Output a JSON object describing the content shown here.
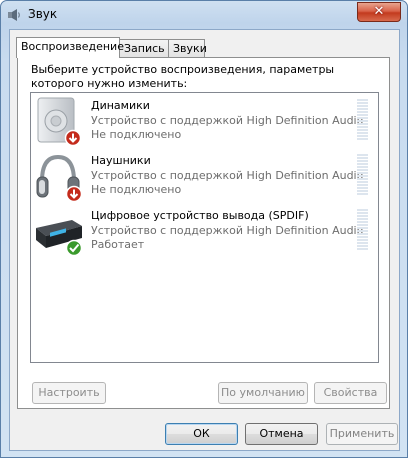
{
  "window": {
    "title": "Звук",
    "app_icon": "speaker-icon",
    "close_glyph": "✕"
  },
  "tabs": [
    {
      "label": "Воспроизведение",
      "active": true
    },
    {
      "label": "Запись",
      "active": false
    },
    {
      "label": "Звуки",
      "active": false
    }
  ],
  "instruction": "Выберите устройство воспроизведения, параметры которого нужно изменить:",
  "devices": [
    {
      "name": "Динамики",
      "description": "Устройство с поддержкой High Definition Audio",
      "status": "Не подключено",
      "icon": "speakers-icon",
      "badge": "disconnected-badge-icon"
    },
    {
      "name": "Наушники",
      "description": "Устройство с поддержкой High Definition Audio",
      "status": "Не подключено",
      "icon": "headphones-icon",
      "badge": "disconnected-badge-icon"
    },
    {
      "name": "Цифровое устройство вывода (SPDIF)",
      "description": "Устройство с поддержкой High Definition Audio",
      "status": "Работает",
      "icon": "digital-output-icon",
      "badge": "check-badge-icon"
    }
  ],
  "panel_buttons": {
    "configure": "Настроить",
    "set_default": "По умолчанию",
    "properties": "Свойства"
  },
  "dialog_buttons": {
    "ok": "ОК",
    "cancel": "Отмена",
    "apply": "Применить"
  },
  "colors": {
    "title_bar": "#c4d8ee",
    "close_button": "#c9452a",
    "meter_empty": "#dde5ee",
    "disconnected": "#c42b1c",
    "ok": "#3a9a2c"
  }
}
